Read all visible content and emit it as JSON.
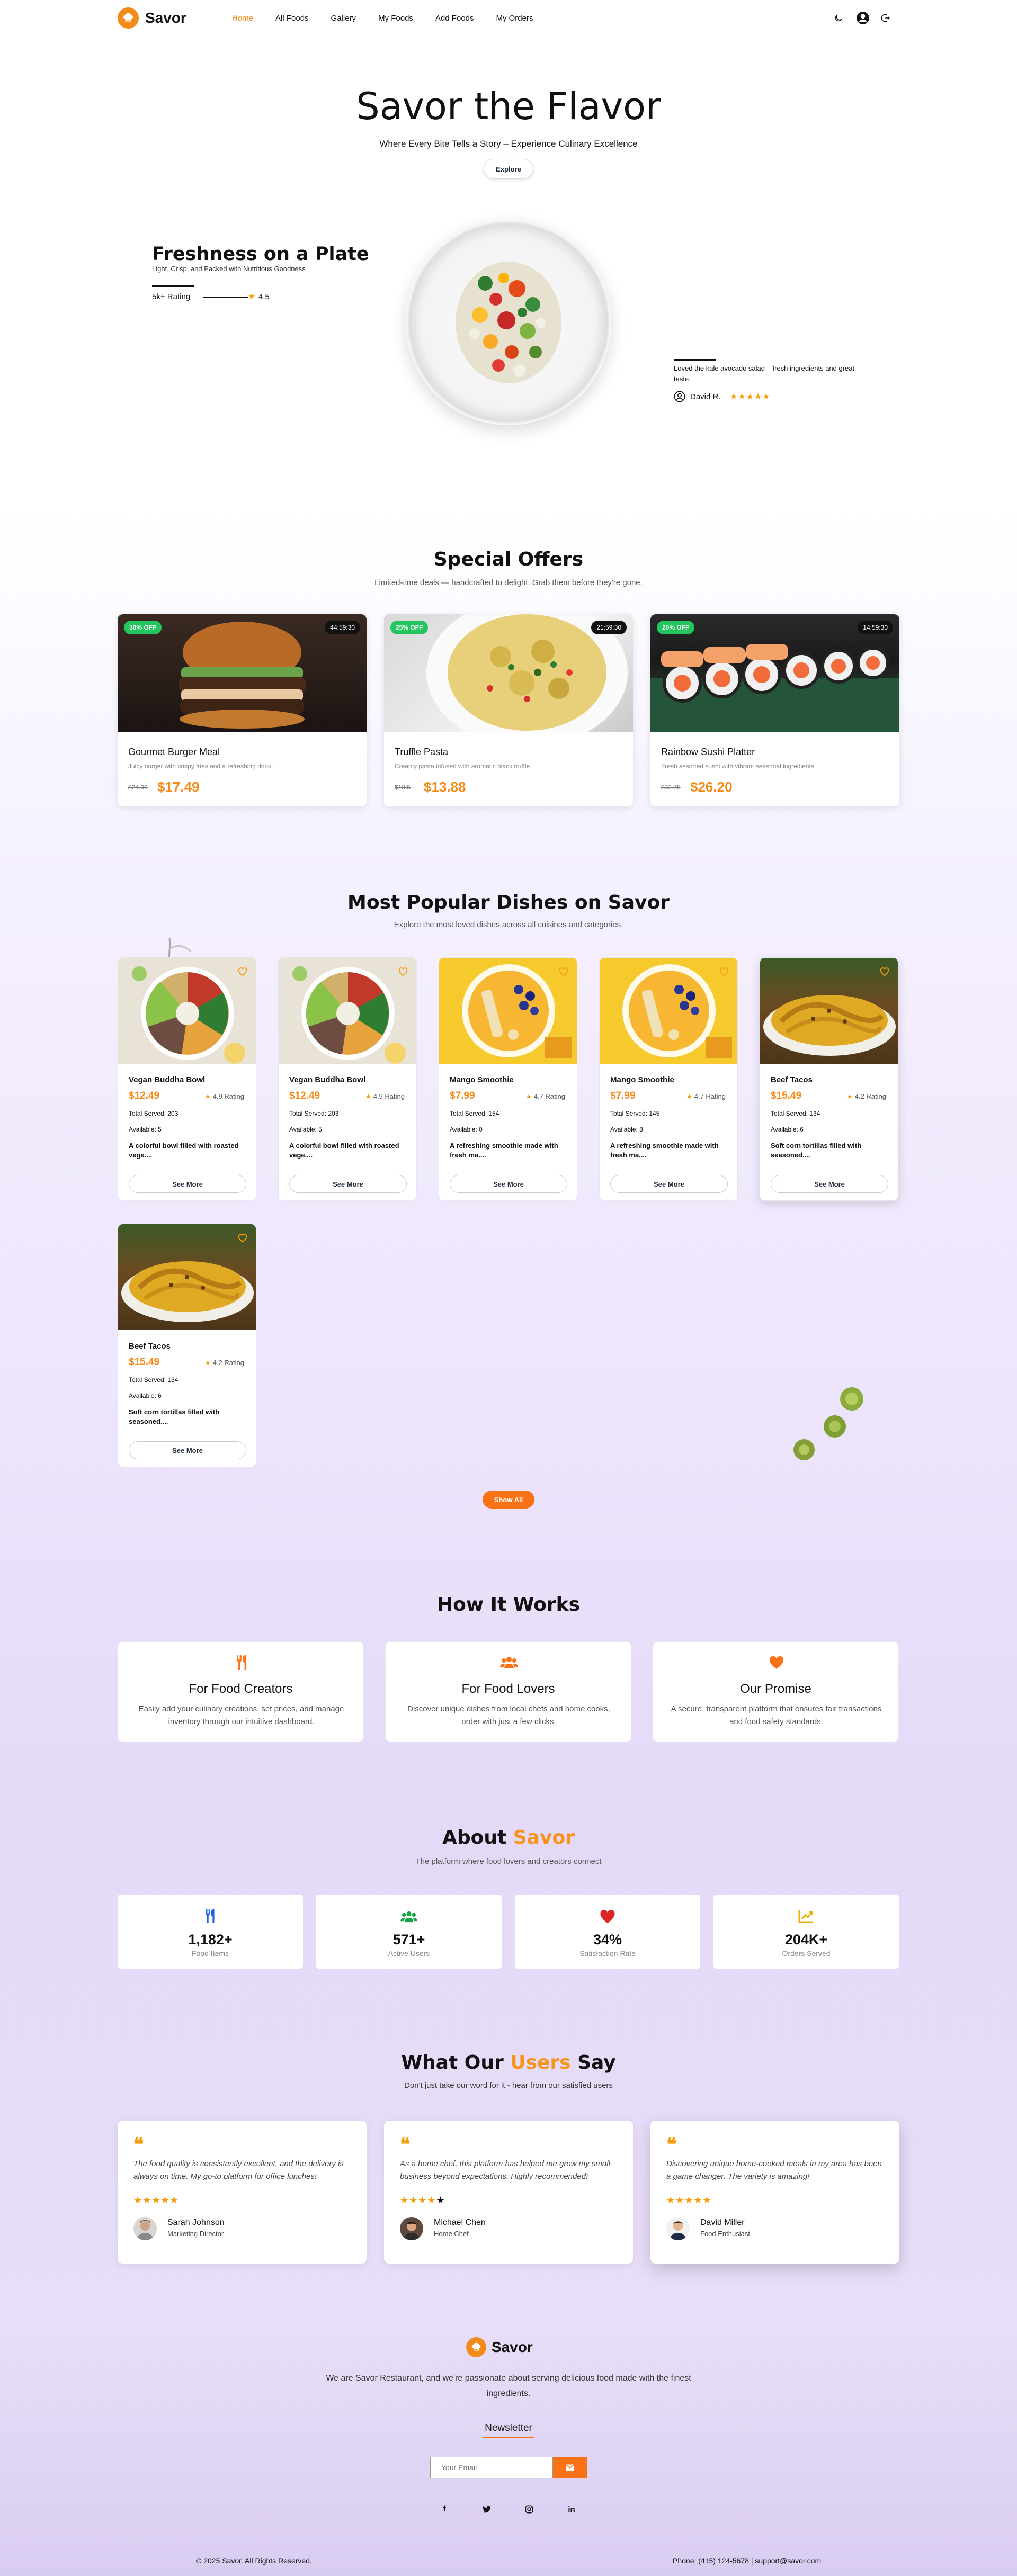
{
  "brand": {
    "name": "Savor",
    "accent": "#f38b1a"
  },
  "nav": {
    "links": [
      "Home",
      "All Foods",
      "Gallery",
      "My Foods",
      "Add Foods",
      "My Orders"
    ],
    "active": "Home",
    "icons": [
      "moon-icon",
      "user-avatar-icon",
      "logout-icon"
    ]
  },
  "hero": {
    "title": "Savor the Flavor",
    "subtitle": "Where Every Bite Tells a Story – Experience Culinary Excellence",
    "button": "Explore",
    "feature_title": "Freshness on a Plate",
    "feature_sub": "Light, Crisp, and Packed with Nutritious Goodness",
    "rating_label": "5k+ Rating",
    "rating_value": "4.5",
    "review_text": "Loved the kale avocado salad – fresh ingredients and great taste.",
    "reviewer": "David R.",
    "reviewer_stars": "★★★★★"
  },
  "offers": {
    "title": "Special Offers",
    "subtitle": "Limited-time deals — handcrafted to delight. Grab them before they're gone.",
    "items": [
      {
        "badge": "30% OFF",
        "timer": "44:59:30",
        "name": "Gourmet Burger Meal",
        "desc": "Juicy burger with crispy fries and a refreshing drink.",
        "old": "$24.99",
        "new": "$17.49"
      },
      {
        "badge": "25% OFF",
        "timer": "21:59:30",
        "name": "Truffle Pasta",
        "desc": "Creamy pasta infused with aromatic black truffle.",
        "old": "$18.5",
        "new": "$13.88"
      },
      {
        "badge": "20% OFF",
        "timer": "14:59:30",
        "name": "Rainbow Sushi Platter",
        "desc": "Fresh assorted sushi with vibrant seasonal ingredients.",
        "old": "$32.75",
        "new": "$26.20"
      }
    ]
  },
  "popular": {
    "title": "Most Popular Dishes on Savor",
    "subtitle": "Explore the most loved dishes across all cuisines and categories.",
    "button": "See More",
    "show_all": "Show All",
    "items": [
      {
        "name": "Vegan Buddha Bowl",
        "price": "$12.49",
        "rating": "4.9 Rating",
        "served": "Total Served: 203",
        "available": "Available: 5",
        "desc": "A colorful bowl filled with roasted vege...."
      },
      {
        "name": "Vegan Buddha Bowl",
        "price": "$12.49",
        "rating": "4.9 Rating",
        "served": "Total Served: 203",
        "available": "Available: 5",
        "desc": "A colorful bowl filled with roasted vege...."
      },
      {
        "name": "Mango Smoothie",
        "price": "$7.99",
        "rating": "4.7 Rating",
        "served": "Total Served: 154",
        "available": "Available: 0",
        "desc": "A refreshing smoothie made with fresh ma...."
      },
      {
        "name": "Mango Smoothie",
        "price": "$7.99",
        "rating": "4.7 Rating",
        "served": "Total Served: 145",
        "available": "Available: 8",
        "desc": "A refreshing smoothie made with fresh ma...."
      },
      {
        "name": "Beef Tacos",
        "price": "$15.49",
        "rating": "4.2 Rating",
        "served": "Total Served: 134",
        "available": "Available: 6",
        "desc": "Soft corn tortillas filled with seasoned...."
      },
      {
        "name": "Beef Tacos",
        "price": "$15.49",
        "rating": "4.2 Rating",
        "served": "Total Served: 134",
        "available": "Available: 6",
        "desc": "Soft corn tortillas filled with seasoned...."
      }
    ]
  },
  "how": {
    "title": "How It Works",
    "items": [
      {
        "icon": "utensils-icon",
        "title": "For Food Creators",
        "text": "Easily add your culinary creations, set prices, and manage inventory through our intuitive dashboard."
      },
      {
        "icon": "users-icon",
        "title": "For Food Lovers",
        "text": "Discover unique dishes from local chefs and home cooks, order with just a few clicks."
      },
      {
        "icon": "heart-icon",
        "title": "Our Promise",
        "text": "A secure, transparent platform that ensures fair transactions and food safety standards."
      }
    ]
  },
  "about": {
    "title_prefix": "About",
    "title_accent": "Savor",
    "subtitle": "The platform where food lovers and creators connect",
    "stats": [
      {
        "icon": "utensils-icon",
        "color": "#2563eb",
        "value": "1,182+",
        "label": "Food Items"
      },
      {
        "icon": "users-icon",
        "color": "#16a34a",
        "value": "571+",
        "label": "Active Users"
      },
      {
        "icon": "heart-icon",
        "color": "#dc2626",
        "value": "34%",
        "label": "Satisfaction Rate"
      },
      {
        "icon": "chart-icon",
        "color": "#eab308",
        "value": "204K+",
        "label": "Orders Served"
      }
    ]
  },
  "testimonials": {
    "title_prefix": "What Our",
    "title_accent": "Users",
    "title_suffix": "Say",
    "subtitle": "Don't just take our word for it - hear from our satisfied users",
    "items": [
      {
        "text": "The food quality is consistently excellent, and the delivery is always on time. My go-to platform for office lunches!",
        "stars": "★★★★★",
        "name": "Sarah Johnson",
        "role": "Marketing Director"
      },
      {
        "text": "As a home chef, this platform has helped me grow my small business beyond expectations. Highly recommended!",
        "stars": "★★★★",
        "name": "Michael Chen",
        "role": "Home Chef"
      },
      {
        "text": "Discovering unique home-cooked meals in my area has been a game changer. The variety is amazing!",
        "stars": "★★★★★",
        "name": "David Miller",
        "role": "Food Enthusiast"
      }
    ]
  },
  "footer": {
    "brand": "Savor",
    "about": "We are Savor Restaurant, and we're passionate about serving delicious food made with the finest ingredients.",
    "newsletter_title": "Newsletter",
    "email_placeholder": "Your Email",
    "socials": [
      "facebook-icon",
      "twitter-icon",
      "instagram-icon",
      "linkedin-icon"
    ],
    "copyright": "© 2025 Savor. All Rights Reserved.",
    "contact": "Phone: (415) 124-5678 | support@savor.com"
  }
}
